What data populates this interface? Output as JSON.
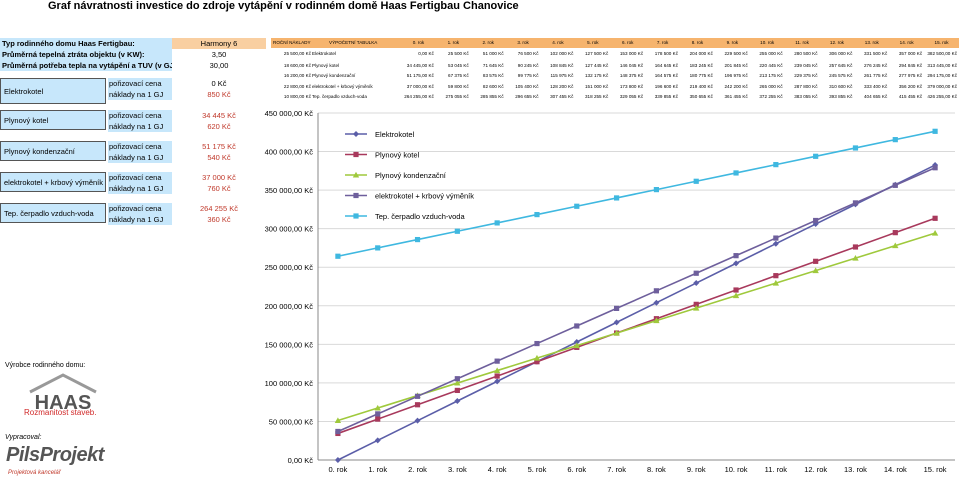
{
  "title": "Graf návratnosti investice do zdroje vytápění v rodinném domě Haas Fertigbau Chanovice",
  "params": {
    "house_type_label": "Typ rodinného domu Haas Fertigbau:",
    "house_type_value": "Harmony 6",
    "heat_loss_label": "Průměrná tepelná ztráta objektu (v KW):",
    "heat_loss_value": "3,50",
    "heat_need_label": "Průměrná potřeba tepla na vytápění a TUV (v GJ)",
    "heat_need_value": "30,00"
  },
  "sources": [
    {
      "name": "Elektrokotel",
      "price_label": "pořizovací cena",
      "price": "0 Kč",
      "cost_label": "náklady na 1 GJ",
      "cost": "850 Kč"
    },
    {
      "name": "Plynový kotel",
      "price_label": "pořizovací cena",
      "price": "34 445 Kč",
      "cost_label": "náklady na 1 GJ",
      "cost": "620 Kč"
    },
    {
      "name": "Plynový kondenzační",
      "price_label": "pořizovací cena",
      "price": "51 175 Kč",
      "cost_label": "náklady na 1 GJ",
      "cost": "540 Kč"
    },
    {
      "name": "elektrokotel + krbový výměník",
      "price_label": "pořizovací cena",
      "price": "37 000 Kč",
      "cost_label": "náklady na 1 GJ",
      "cost": "760 Kč"
    },
    {
      "name": "Tep. čerpadlo vzduch-voda",
      "price_label": "pořizovací cena",
      "price": "264 255 Kč",
      "cost_label": "náklady na 1 GJ",
      "cost": "360 Kč"
    }
  ],
  "table": {
    "h_costs": "ROČNÍ NÁKLADY",
    "h_calc": "VÝPOČETNÍ TABULKA",
    "years": [
      "0. rok",
      "1. rok",
      "2. rok",
      "3. rok",
      "4. rok",
      "5. rok",
      "6. rok",
      "7. rok",
      "8. rok",
      "9. rok",
      "10. rok",
      "11. rok",
      "12. rok",
      "13. rok",
      "14. rok",
      "15. rok"
    ],
    "rows": [
      {
        "annual": "25 500,00 Kč",
        "name": "Elektrokotel",
        "cells": [
          "0,00 Kč",
          "25 500 Kč",
          "51 000 Kč",
          "76 500 Kč",
          "102 000 Kč",
          "127 500 Kč",
          "153 000 Kč",
          "178 500 Kč",
          "204 000 Kč",
          "229 500 Kč",
          "255 000 Kč",
          "280 500 Kč",
          "306 000 Kč",
          "331 500 Kč",
          "357 000 Kč",
          "382 500,00 Kč"
        ]
      },
      {
        "annual": "18 600,00 Kč",
        "name": "Plynový kotel",
        "cells": [
          "34 445,00 Kč",
          "53 045 Kč",
          "71 645 Kč",
          "90 245 Kč",
          "108 845 Kč",
          "127 445 Kč",
          "146 045 Kč",
          "164 645 Kč",
          "183 245 Kč",
          "201 845 Kč",
          "220 445 Kč",
          "239 045 Kč",
          "257 645 Kč",
          "276 245 Kč",
          "294 845 Kč",
          "313 445,00 Kč"
        ]
      },
      {
        "annual": "16 200,00 Kč",
        "name": "Plynový kondenzační",
        "cells": [
          "51 175,00 Kč",
          "67 375 Kč",
          "83 575 Kč",
          "99 775 Kč",
          "115 975 Kč",
          "132 175 Kč",
          "148 375 Kč",
          "164 575 Kč",
          "180 775 Kč",
          "196 975 Kč",
          "213 175 Kč",
          "229 375 Kč",
          "245 575 Kč",
          "261 775 Kč",
          "277 975 Kč",
          "294 175,00 Kč"
        ]
      },
      {
        "annual": "22 800,00 Kč",
        "name": "elektrokotel + krbový výměník",
        "cells": [
          "37 000,00 Kč",
          "59 800 Kč",
          "82 600 Kč",
          "105 400 Kč",
          "128 200 Kč",
          "151 000 Kč",
          "173 800 Kč",
          "196 600 Kč",
          "219 400 Kč",
          "242 200 Kč",
          "265 000 Kč",
          "287 800 Kč",
          "310 600 Kč",
          "333 400 Kč",
          "356 200 Kč",
          "379 000,00 Kč"
        ]
      },
      {
        "annual": "10 800,00 Kč",
        "name": "Tep. čerpadlo vzduch-voda",
        "cells": [
          "264 255,00 Kč",
          "275 055 Kč",
          "285 855 Kč",
          "296 655 Kč",
          "307 455 Kč",
          "318 255 Kč",
          "329 055 Kč",
          "339 855 Kč",
          "350 655 Kč",
          "361 455 Kč",
          "372 255 Kč",
          "383 055 Kč",
          "393 855 Kč",
          "404 655 Kč",
          "415 455 Kč",
          "426 255,00 Kč"
        ]
      }
    ]
  },
  "logos": {
    "maker_label": "Výrobce rodinného domu:",
    "maker_name": "HAAS",
    "maker_slogan": "Rozmanitost staveb.",
    "calc_label": "Vypracoval:",
    "calc_name": "PilsProjekt",
    "calc_sub": "Projektová kancelář"
  },
  "colors": {
    "elektrokotel": "#5b5ea8",
    "plynovy_kotel": "#a8395c",
    "kondenzacni": "#9fc93c",
    "krb": "#6e5f9c",
    "tc": "#3fb8e0"
  },
  "chart_data": {
    "type": "line",
    "title": "",
    "xlabel": "",
    "ylabel": "",
    "categories": [
      "0. rok",
      "1. rok",
      "2. rok",
      "3. rok",
      "4. rok",
      "5. rok",
      "6. rok",
      "7. rok",
      "8. rok",
      "9. rok",
      "10. rok",
      "11. rok",
      "12. rok",
      "13. rok",
      "14. rok",
      "15. rok"
    ],
    "ylim": [
      0,
      450000
    ],
    "yticks": [
      "0,00 Kč",
      "50 000,00 Kč",
      "100 000,00 Kč",
      "150 000,00 Kč",
      "200 000,00 Kč",
      "250 000,00 Kč",
      "300 000,00 Kč",
      "350 000,00 Kč",
      "400 000,00 Kč",
      "450 000,00 Kč"
    ],
    "grid": true,
    "legend": "top-center",
    "series": [
      {
        "name": "Elektrokotel",
        "color": "#5b5ea8",
        "marker": "diamond",
        "values": [
          0,
          25500,
          51000,
          76500,
          102000,
          127500,
          153000,
          178500,
          204000,
          229500,
          255000,
          280500,
          306000,
          331500,
          357000,
          382500
        ]
      },
      {
        "name": "Plynový kotel",
        "color": "#a8395c",
        "marker": "square",
        "values": [
          34445,
          53045,
          71645,
          90245,
          108845,
          127445,
          146045,
          164645,
          183245,
          201845,
          220445,
          239045,
          257645,
          276245,
          294845,
          313445
        ]
      },
      {
        "name": "Plynový kondenzační",
        "color": "#9fc93c",
        "marker": "triangle",
        "values": [
          51175,
          67375,
          83575,
          99775,
          115975,
          132175,
          148375,
          164575,
          180775,
          196975,
          213175,
          229375,
          245575,
          261775,
          277975,
          294175
        ]
      },
      {
        "name": "elektrokotel + krbový výměník",
        "color": "#6e5f9c",
        "marker": "square",
        "values": [
          37000,
          59800,
          82600,
          105400,
          128200,
          151000,
          173800,
          196600,
          219400,
          242200,
          265000,
          287800,
          310600,
          333400,
          356200,
          379000
        ]
      },
      {
        "name": "Tep. čerpadlo vzduch-voda",
        "color": "#3fb8e0",
        "marker": "square",
        "values": [
          264255,
          275055,
          285855,
          296655,
          307455,
          318255,
          329055,
          339855,
          350655,
          361455,
          372255,
          383055,
          393855,
          404655,
          415455,
          426255
        ]
      }
    ]
  }
}
